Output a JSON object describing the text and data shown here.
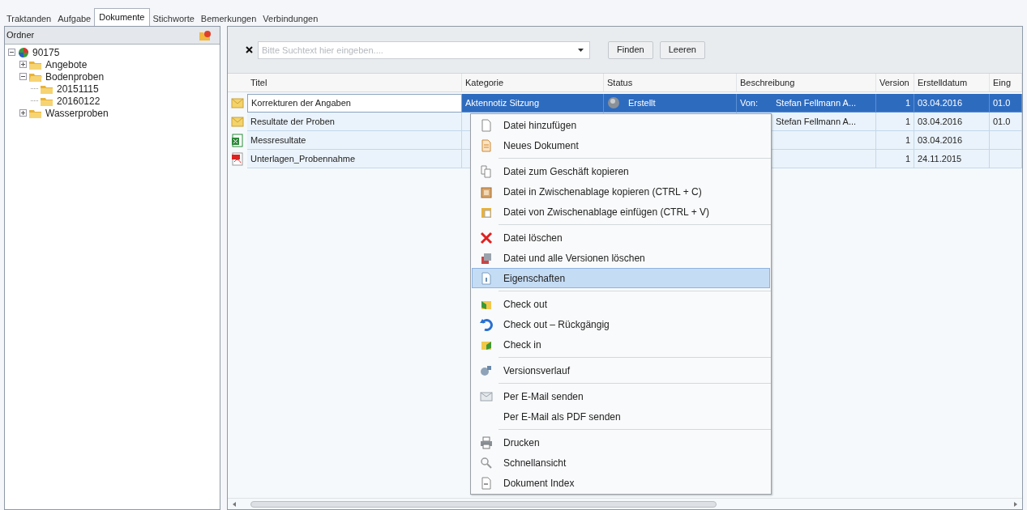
{
  "tabs": [
    {
      "label": "Traktanden",
      "selected": false
    },
    {
      "label": "Aufgabe",
      "selected": false
    },
    {
      "label": "Dokumente",
      "selected": true
    },
    {
      "label": "Stichworte",
      "selected": false
    },
    {
      "label": "Bemerkungen",
      "selected": false
    },
    {
      "label": "Verbindungen",
      "selected": false
    }
  ],
  "folder_panel": {
    "title": "Ordner",
    "tree": [
      {
        "label": "90175",
        "expanded": true,
        "children": [
          {
            "label": "Angebote",
            "expanded": false
          },
          {
            "label": "Bodenproben",
            "expanded": true,
            "children": [
              {
                "label": "20151115"
              },
              {
                "label": "20160122"
              }
            ]
          },
          {
            "label": "Wasserproben",
            "expanded": false
          }
        ]
      }
    ]
  },
  "search": {
    "placeholder": "Bitte Suchtext hier eingeben....",
    "buttons": [
      "Finden",
      "Leeren"
    ]
  },
  "table": {
    "columns": [
      "Titel",
      "Kategorie",
      "Status",
      "Beschreibung",
      "Version",
      "Erstelldatum",
      "Eing"
    ],
    "rows": [
      {
        "kind": "mail",
        "selected": true,
        "titel": "Korrekturen der Angaben",
        "kategorie": "Aktennotiz Sitzung",
        "status": "Erstellt",
        "beschreibung_prefix": "Von:",
        "beschreibung": "Stefan Fellmann A...",
        "version": "1",
        "erstelldatum": "03.04.2016",
        "eing": "01.0"
      },
      {
        "kind": "mail",
        "selected": false,
        "titel": "Resultate der Proben",
        "beschreibung": "Stefan Fellmann A...",
        "version": "1",
        "erstelldatum": "03.04.2016",
        "eing": "01.0"
      },
      {
        "kind": "spreadsheet",
        "selected": false,
        "titel": "Messresultate",
        "version": "1",
        "erstelldatum": "03.04.2016"
      },
      {
        "kind": "pdf",
        "selected": false,
        "titel": "Unterlagen_Probennahme",
        "version": "1",
        "erstelldatum": "24.11.2015"
      }
    ]
  },
  "context_menu": [
    {
      "kind": "item",
      "label": "Datei hinzufügen",
      "selected": false
    },
    {
      "kind": "item",
      "label": "Neues Dokument",
      "selected": false
    },
    {
      "kind": "separator"
    },
    {
      "kind": "item",
      "label": "Datei zum Geschäft kopieren",
      "selected": false
    },
    {
      "kind": "item",
      "label": "Datei in Zwischenablage kopieren (CTRL + C)",
      "selected": false
    },
    {
      "kind": "item",
      "label": "Datei von Zwischenablage einfügen (CTRL + V)",
      "selected": false
    },
    {
      "kind": "separator"
    },
    {
      "kind": "item",
      "label": "Datei löschen",
      "selected": false
    },
    {
      "kind": "item",
      "label": "Datei und alle Versionen löschen",
      "selected": false
    },
    {
      "kind": "item",
      "label": "Eigenschaften",
      "selected": true
    },
    {
      "kind": "separator"
    },
    {
      "kind": "item",
      "label": "Check out",
      "selected": false
    },
    {
      "kind": "item",
      "label": "Check out – Rückgängig",
      "selected": false
    },
    {
      "kind": "item",
      "label": "Check in",
      "selected": false
    },
    {
      "kind": "separator"
    },
    {
      "kind": "item",
      "label": "Versionsverlauf",
      "selected": false
    },
    {
      "kind": "separator"
    },
    {
      "kind": "item",
      "label": "Per E-Mail senden",
      "selected": false
    },
    {
      "kind": "item",
      "label": "Per E-Mail als PDF senden",
      "selected": false
    },
    {
      "kind": "separator"
    },
    {
      "kind": "item",
      "label": "Drucken",
      "selected": false
    },
    {
      "kind": "item",
      "label": "Schnellansicht",
      "selected": false
    },
    {
      "kind": "item",
      "label": "Dokument Index",
      "selected": false
    }
  ]
}
